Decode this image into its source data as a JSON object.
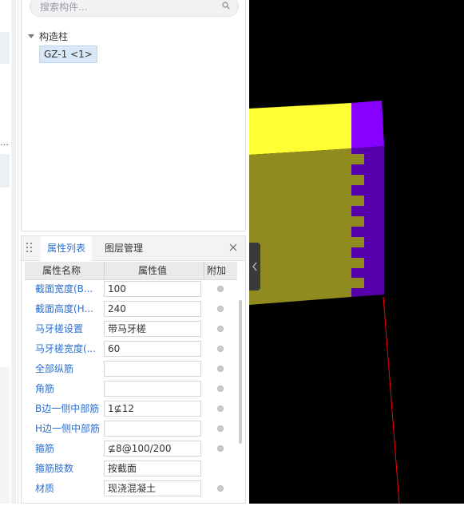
{
  "search": {
    "placeholder": "搜索构件..."
  },
  "tree": {
    "root_label": "构造柱",
    "nodes": [
      {
        "label": "GZ-1 <1>"
      }
    ]
  },
  "properties": {
    "tabs": [
      {
        "label": "属性列表",
        "active": true
      },
      {
        "label": "图层管理",
        "active": false
      }
    ],
    "columns": {
      "name": "属性名称",
      "value": "属性值",
      "extra": "附加"
    },
    "rows": [
      {
        "name": "截面宽度(B...",
        "value": "100"
      },
      {
        "name": "截面高度(H...",
        "value": "240"
      },
      {
        "name": "马牙槎设置",
        "value": "带马牙槎"
      },
      {
        "name": "马牙槎宽度(...",
        "value": "60"
      },
      {
        "name": "全部纵筋",
        "value": ""
      },
      {
        "name": "角筋",
        "value": ""
      },
      {
        "name": "B边一侧中部筋",
        "value": "1⊈12"
      },
      {
        "name": "H边一侧中部筋",
        "value": ""
      },
      {
        "name": "箍筋",
        "value": "⊈8@100/200"
      },
      {
        "name": "箍筋肢数",
        "value": "按截面"
      },
      {
        "name": "材质",
        "value": "现浇混凝土"
      }
    ]
  },
  "viewport": {
    "colors": {
      "background": "#000000",
      "top_face": "#ffff33",
      "front_face": "#8f8b1f",
      "end_top": "#8800ff",
      "end_face": "#5500aa",
      "axis": "#ff0000"
    }
  }
}
